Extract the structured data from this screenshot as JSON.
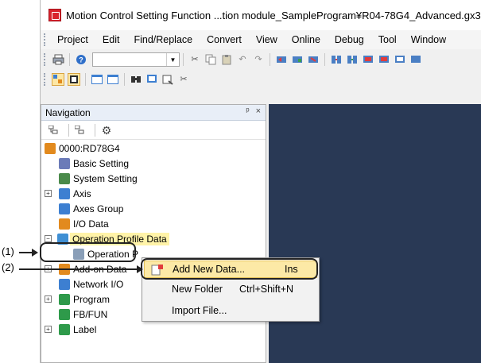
{
  "window": {
    "title": "Motion Control Setting Function ...tion module_SampleProgram¥R04-78G4_Advanced.gx3"
  },
  "menubar": {
    "items": [
      "Project",
      "Edit",
      "Find/Replace",
      "Convert",
      "View",
      "Online",
      "Debug",
      "Tool",
      "Window"
    ]
  },
  "navigation": {
    "title": "Navigation",
    "pin_glyph": "ᵖ",
    "close_glyph": "×",
    "tree": [
      {
        "label": "0000:RD78G4",
        "icon": "module-icon",
        "color": "#e28a1e"
      },
      {
        "label": "Basic Setting",
        "icon": "basic-setting-icon",
        "color": "#6b7bb8"
      },
      {
        "label": "System Setting",
        "icon": "system-setting-icon",
        "color": "#4a8a4a"
      },
      {
        "label": "Axis",
        "icon": "axis-icon",
        "color": "#3d7fd1"
      },
      {
        "label": "Axes Group",
        "icon": "axes-group-icon",
        "color": "#3d7fd1"
      },
      {
        "label": "I/O Data",
        "icon": "io-data-icon",
        "color": "#e28a1e"
      },
      {
        "label": "Operation Profile Data",
        "icon": "operation-profile-icon",
        "color": "#3f8fd4"
      },
      {
        "label": "Operation P",
        "icon": "operation-profile-item-icon",
        "color": "#8a9fb8"
      },
      {
        "label": "Add-on Data",
        "icon": "add-on-data-icon",
        "color": "#e28a1e"
      },
      {
        "label": "Network I/O",
        "icon": "network-io-icon",
        "color": "#3d7fd1"
      },
      {
        "label": "Program",
        "icon": "program-icon",
        "color": "#2e9a4a"
      },
      {
        "label": "FB/FUN",
        "icon": "fb-fun-icon",
        "color": "#2e9a4a"
      },
      {
        "label": "Label",
        "icon": "label-icon",
        "color": "#2e9a4a"
      }
    ]
  },
  "context_menu": {
    "items": [
      {
        "label": "Add New Data...",
        "shortcut": "Ins"
      },
      {
        "label": "New Folder",
        "shortcut": "Ctrl+Shift+N"
      },
      {
        "label": "Import File...",
        "shortcut": ""
      }
    ]
  },
  "callouts": {
    "one": "(1)",
    "two": "(2)"
  },
  "colors": {
    "editor_background": "#293955",
    "selection_highlight": "#fff3a8",
    "context_menu_highlight": "#fce9a6"
  }
}
